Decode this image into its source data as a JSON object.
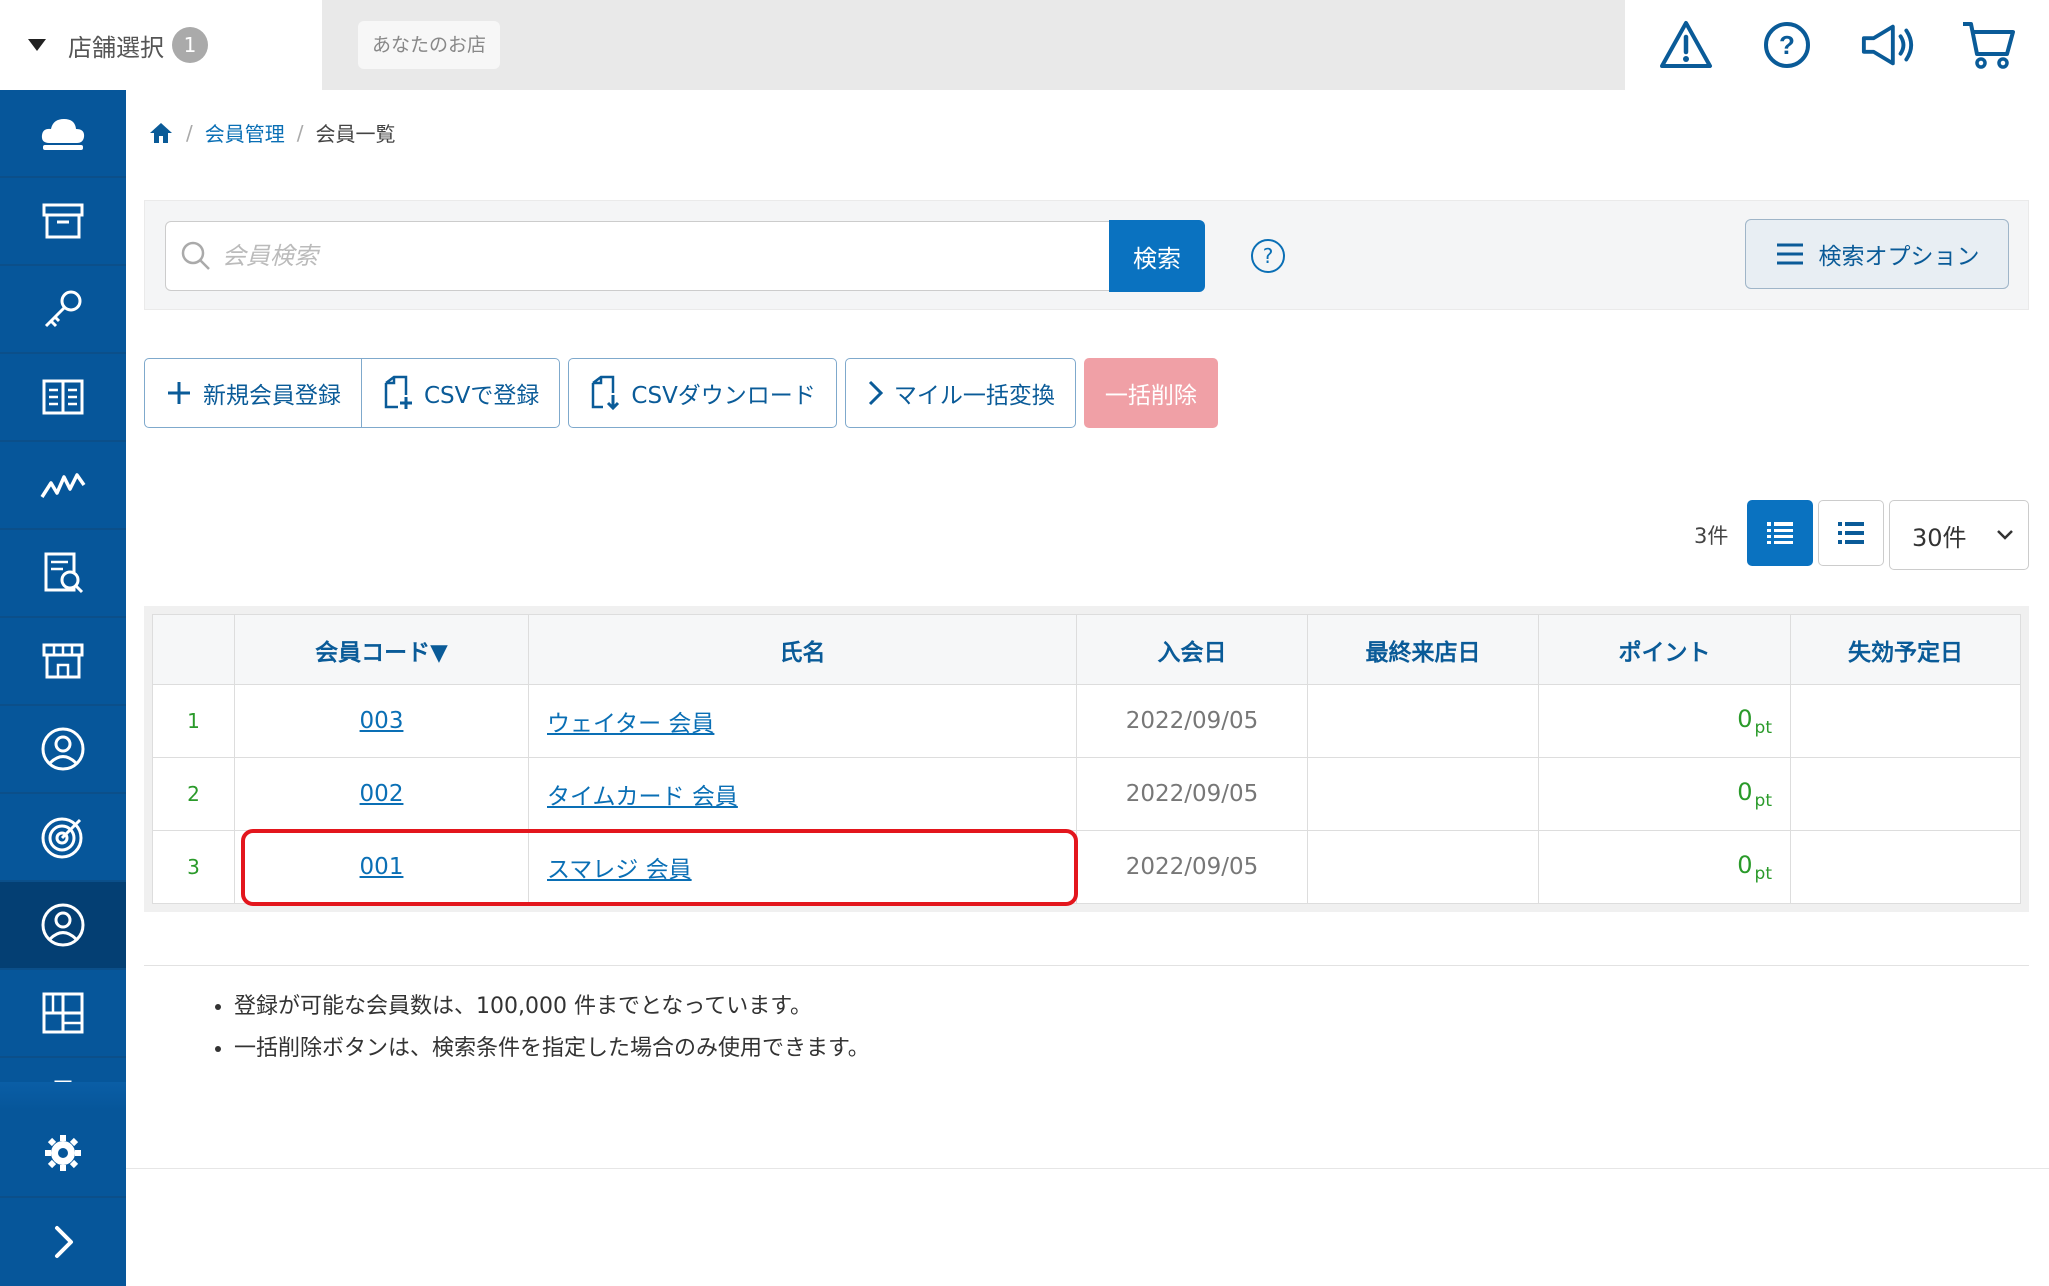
{
  "topbar": {
    "store_select_label": "店舗選択",
    "store_count": "1",
    "shop_name": "あなたのお店",
    "icons": [
      "warning-icon",
      "help-icon",
      "announcement-icon",
      "cart-icon"
    ]
  },
  "sidebar": {
    "items": [
      "cloud-icon",
      "archive-icon",
      "key-icon",
      "book-icon",
      "chart-icon",
      "report-icon",
      "store-icon",
      "user-icon",
      "target-icon",
      "member-icon",
      "grid-icon",
      "clipboard-icon"
    ],
    "active": "member-icon",
    "bottom": [
      "gear-icon",
      "expand-icon"
    ]
  },
  "breadcrumb": {
    "home": "home-icon",
    "parent": "会員管理",
    "current": "会員一覧"
  },
  "search": {
    "placeholder": "会員検索",
    "button": "検索",
    "help": "?",
    "option_button": "検索オプション"
  },
  "actions": {
    "new_member": "新規会員登録",
    "csv_register": "CSVで登録",
    "csv_download": "CSVダウンロード",
    "mile_convert": "マイル一括変換",
    "bulk_delete": "一括削除"
  },
  "list": {
    "count": "3件",
    "per_page": "30件"
  },
  "table": {
    "columns": [
      "会員コード▼",
      "氏名",
      "入会日",
      "最終来店日",
      "ポイント",
      "失効予定日"
    ],
    "rows": [
      {
        "idx": "1",
        "code": "003",
        "name": "ウェイター 会員",
        "joined": "2022/09/05",
        "last_visit": "",
        "points": "0",
        "unit": "pt",
        "expiry": ""
      },
      {
        "idx": "2",
        "code": "002",
        "name": "タイムカード 会員",
        "joined": "2022/09/05",
        "last_visit": "",
        "points": "0",
        "unit": "pt",
        "expiry": ""
      },
      {
        "idx": "3",
        "code": "001",
        "name": "スマレジ 会員",
        "joined": "2022/09/05",
        "last_visit": "",
        "points": "0",
        "unit": "pt",
        "expiry": ""
      }
    ]
  },
  "notes": [
    "登録が可能な会員数は、100,000 件までとなっています。",
    "一括削除ボタンは、検索条件を指定した場合のみ使用できます。"
  ],
  "colors": {
    "sidebar": "#06569a",
    "primary": "#0a72c0",
    "danger": "#f0a0a6",
    "highlight": "#e3161d"
  }
}
